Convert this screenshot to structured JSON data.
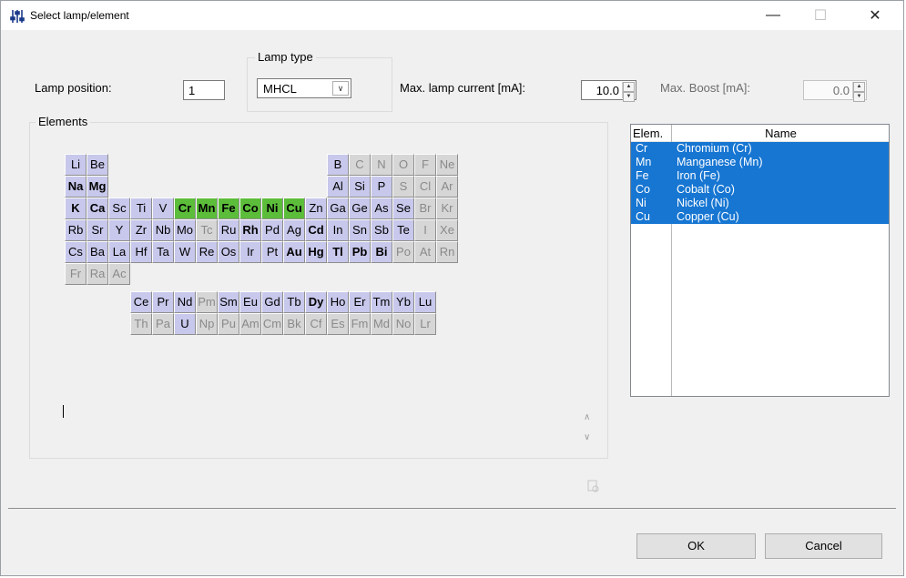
{
  "window": {
    "title": "Select lamp/element",
    "controls": {
      "minimize": "—",
      "maximize": "☐",
      "close": "✕"
    }
  },
  "lamp_position": {
    "label": "Lamp position:",
    "value": "1"
  },
  "lamp_type": {
    "group_title": "Lamp type",
    "selected": "MHCL"
  },
  "max_current": {
    "label": "Max. lamp current [mA]:",
    "value": "10.0"
  },
  "max_boost": {
    "label": "Max. Boost [mA]:",
    "value": "0.0"
  },
  "elements": {
    "group_title": "Elements",
    "legend": {
      "a": "available",
      "b": "available (bold)",
      "s": "selected",
      "u": "unavailable"
    },
    "rows": [
      [
        [
          "Li",
          "a",
          1
        ],
        [
          "Be",
          "a",
          2
        ],
        [
          "B",
          "a",
          13
        ],
        [
          "C",
          "u",
          14
        ],
        [
          "N",
          "u",
          15
        ],
        [
          "O",
          "u",
          16
        ],
        [
          "F",
          "u",
          17
        ],
        [
          "Ne",
          "u",
          18
        ]
      ],
      [
        [
          "Na",
          "b",
          1
        ],
        [
          "Mg",
          "b",
          2
        ],
        [
          "Al",
          "a",
          13
        ],
        [
          "Si",
          "a",
          14
        ],
        [
          "P",
          "a",
          15
        ],
        [
          "S",
          "u",
          16
        ],
        [
          "Cl",
          "u",
          17
        ],
        [
          "Ar",
          "u",
          18
        ]
      ],
      [
        [
          "K",
          "b",
          1
        ],
        [
          "Ca",
          "b",
          2
        ],
        [
          "Sc",
          "a",
          3
        ],
        [
          "Ti",
          "a",
          4
        ],
        [
          "V",
          "a",
          5
        ],
        [
          "Cr",
          "s",
          6
        ],
        [
          "Mn",
          "s",
          7
        ],
        [
          "Fe",
          "s",
          8
        ],
        [
          "Co",
          "s",
          9
        ],
        [
          "Ni",
          "s",
          10
        ],
        [
          "Cu",
          "s",
          11
        ],
        [
          "Zn",
          "a",
          12
        ],
        [
          "Ga",
          "a",
          13
        ],
        [
          "Ge",
          "a",
          14
        ],
        [
          "As",
          "a",
          15
        ],
        [
          "Se",
          "a",
          16
        ],
        [
          "Br",
          "u",
          17
        ],
        [
          "Kr",
          "u",
          18
        ]
      ],
      [
        [
          "Rb",
          "a",
          1
        ],
        [
          "Sr",
          "a",
          2
        ],
        [
          "Y",
          "a",
          3
        ],
        [
          "Zr",
          "a",
          4
        ],
        [
          "Nb",
          "a",
          5
        ],
        [
          "Mo",
          "a",
          6
        ],
        [
          "Tc",
          "u",
          7
        ],
        [
          "Ru",
          "a",
          8
        ],
        [
          "Rh",
          "b",
          9
        ],
        [
          "Pd",
          "a",
          10
        ],
        [
          "Ag",
          "a",
          11
        ],
        [
          "Cd",
          "b",
          12
        ],
        [
          "In",
          "a",
          13
        ],
        [
          "Sn",
          "a",
          14
        ],
        [
          "Sb",
          "a",
          15
        ],
        [
          "Te",
          "a",
          16
        ],
        [
          "I",
          "u",
          17
        ],
        [
          "Xe",
          "u",
          18
        ]
      ],
      [
        [
          "Cs",
          "a",
          1
        ],
        [
          "Ba",
          "a",
          2
        ],
        [
          "La",
          "a",
          3
        ],
        [
          "Hf",
          "a",
          4
        ],
        [
          "Ta",
          "a",
          5
        ],
        [
          "W",
          "a",
          6
        ],
        [
          "Re",
          "a",
          7
        ],
        [
          "Os",
          "a",
          8
        ],
        [
          "Ir",
          "a",
          9
        ],
        [
          "Pt",
          "a",
          10
        ],
        [
          "Au",
          "b",
          11
        ],
        [
          "Hg",
          "b",
          12
        ],
        [
          "Tl",
          "b",
          13
        ],
        [
          "Pb",
          "b",
          14
        ],
        [
          "Bi",
          "b",
          15
        ],
        [
          "Po",
          "u",
          16
        ],
        [
          "At",
          "u",
          17
        ],
        [
          "Rn",
          "u",
          18
        ]
      ],
      [
        [
          "Fr",
          "u",
          1
        ],
        [
          "Ra",
          "u",
          2
        ],
        [
          "Ac",
          "u",
          3
        ]
      ],
      [
        [
          "Ce",
          "a",
          4
        ],
        [
          "Pr",
          "a",
          5
        ],
        [
          "Nd",
          "a",
          6
        ],
        [
          "Pm",
          "u",
          7
        ],
        [
          "Sm",
          "a",
          8
        ],
        [
          "Eu",
          "a",
          9
        ],
        [
          "Gd",
          "a",
          10
        ],
        [
          "Tb",
          "a",
          11
        ],
        [
          "Dy",
          "b",
          12
        ],
        [
          "Ho",
          "a",
          13
        ],
        [
          "Er",
          "a",
          14
        ],
        [
          "Tm",
          "a",
          15
        ],
        [
          "Yb",
          "a",
          16
        ],
        [
          "Lu",
          "a",
          17
        ]
      ],
      [
        [
          "Th",
          "u",
          4
        ],
        [
          "Pa",
          "u",
          5
        ],
        [
          "U",
          "a",
          6
        ],
        [
          "Np",
          "u",
          7
        ],
        [
          "Pu",
          "u",
          8
        ],
        [
          "Am",
          "u",
          9
        ],
        [
          "Cm",
          "u",
          10
        ],
        [
          "Bk",
          "u",
          11
        ],
        [
          "Cf",
          "u",
          12
        ],
        [
          "Es",
          "u",
          13
        ],
        [
          "Fm",
          "u",
          14
        ],
        [
          "Md",
          "u",
          15
        ],
        [
          "No",
          "u",
          16
        ],
        [
          "Lr",
          "u",
          17
        ]
      ]
    ]
  },
  "selected_list": {
    "headers": {
      "elem": "Elem.",
      "name": "Name"
    },
    "items": [
      {
        "elem": "Cr",
        "name": "Chromium (Cr)"
      },
      {
        "elem": "Mn",
        "name": "Manganese (Mn)"
      },
      {
        "elem": "Fe",
        "name": "Iron (Fe)"
      },
      {
        "elem": "Co",
        "name": "Cobalt (Co)"
      },
      {
        "elem": "Ni",
        "name": "Nickel (Ni)"
      },
      {
        "elem": "Cu",
        "name": "Copper (Cu)"
      }
    ]
  },
  "buttons": {
    "ok": "OK",
    "cancel": "Cancel"
  },
  "colors": {
    "available": "#c8c8ec",
    "selected": "#5cbd3a",
    "unavailable": "#d6d6d6",
    "list_highlight": "#1776d2"
  },
  "icons": {
    "app": "sliders-icon",
    "spin_up": "▲",
    "spin_down": "▼",
    "dropdown": "∨",
    "scroll_up": "∧",
    "scroll_down": "∨"
  }
}
